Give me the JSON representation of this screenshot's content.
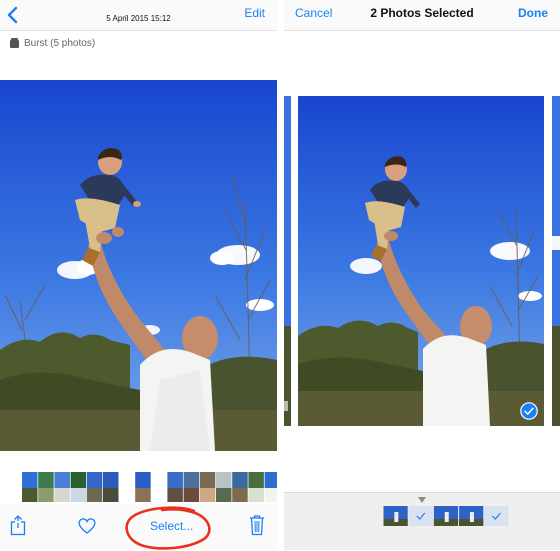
{
  "left": {
    "header": {
      "date": "5 April 2015 15:12",
      "edit_label": "Edit"
    },
    "burst": {
      "label": "Burst (5 photos)"
    },
    "toolbar": {
      "select_label": "Select..."
    },
    "filmstrip_count": 16
  },
  "right": {
    "header": {
      "cancel_label": "Cancel",
      "title": "2 Photos Selected",
      "done_label": "Done"
    },
    "strip_count": 5,
    "selected_thumbs": [
      2,
      5
    ]
  },
  "colors": {
    "accent": "#1a80f7",
    "annotation": "#e8321d",
    "sky_top": "#1a4fd6",
    "sky_bottom": "#5d92e6"
  },
  "icons": {
    "back": "chevron-left-icon",
    "share": "share-icon",
    "favorite": "heart-icon",
    "trash": "trash-icon",
    "check": "checkmark-circle-icon",
    "burst": "burst-stack-icon"
  }
}
